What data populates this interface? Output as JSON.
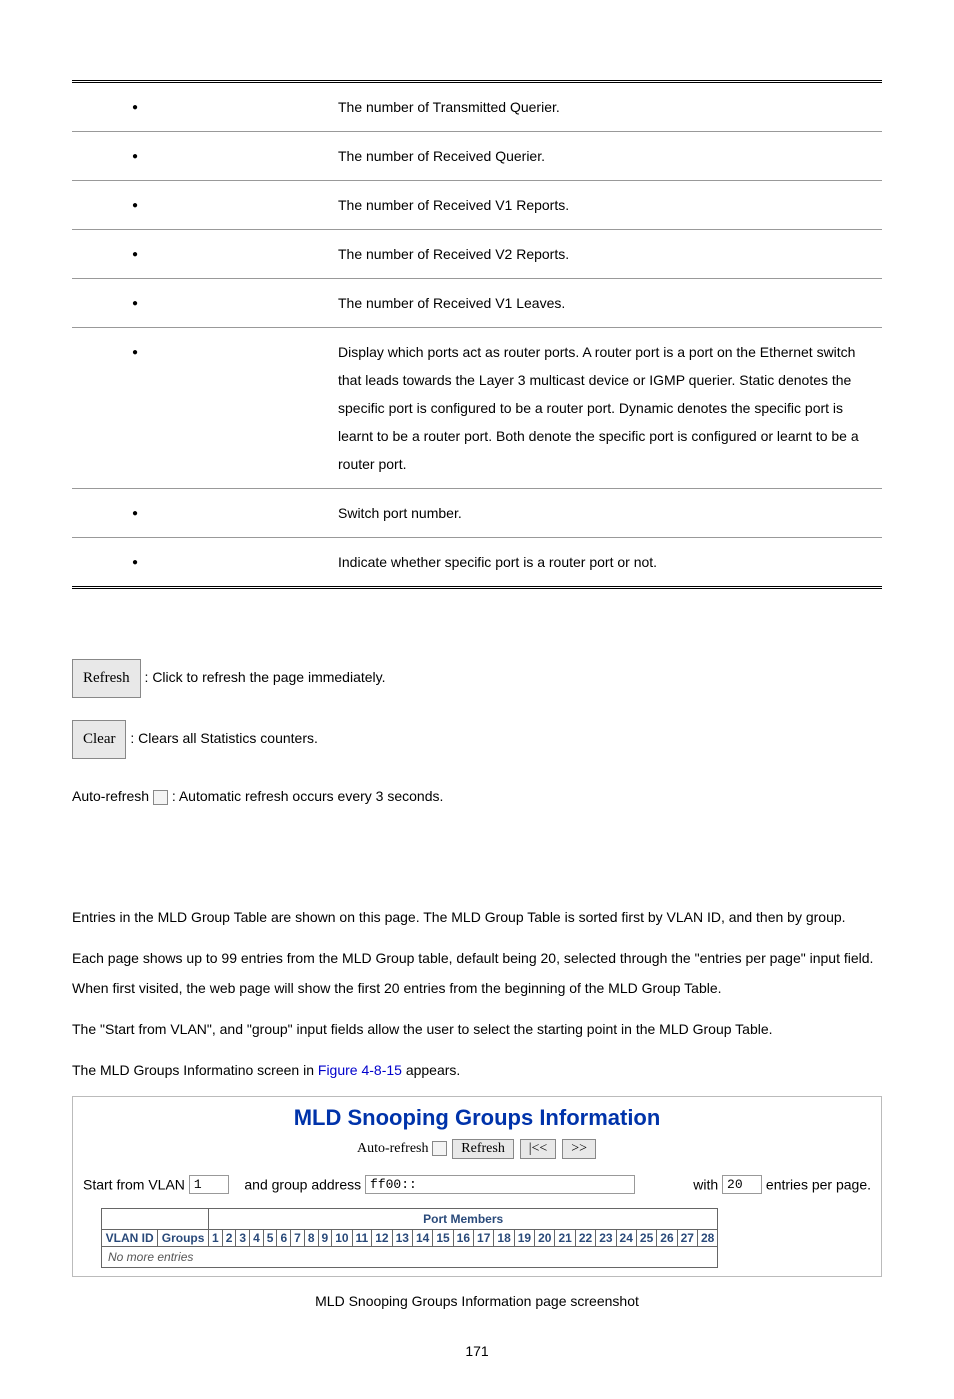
{
  "table_rows": [
    "The number of Transmitted Querier.",
    "The number of Received Querier.",
    "The number of Received V1 Reports.",
    "The number of Received V2 Reports.",
    "The number of Received V1 Leaves.",
    "Display which ports act as router ports. A router port is a port on the Ethernet switch that leads towards the Layer 3 multicast device or IGMP querier. Static denotes the specific port is configured to be a router port. Dynamic denotes the specific port is learnt to be a router port. Both denote the specific port is configured or learnt to be a router port.",
    "Switch port number.",
    "Indicate whether specific port is a router port or not."
  ],
  "buttons": {
    "refresh": "Refresh",
    "refresh_desc": ": Click to refresh the page immediately.",
    "clear": "Clear",
    "clear_desc": ": Clears all Statistics counters.",
    "autorefresh_pre": "Auto-refresh ",
    "autorefresh_desc": ": Automatic refresh occurs every 3 seconds."
  },
  "intro": {
    "p1": "Entries in the MLD Group Table are shown on this page. The MLD Group Table is sorted first by VLAN ID, and then by group.",
    "p2": "Each page shows up to 99 entries from the MLD Group table, default being 20, selected through the \"entries per page\" input field. When first visited, the web page will show the first 20 entries from the beginning of the MLD Group Table.",
    "p3": "The \"Start from VLAN\", and \"group\" input fields allow the user to select the starting point in the MLD Group Table.",
    "p4_pre": "The MLD Groups Informatino screen in ",
    "p4_link": "Figure 4-8-15",
    "p4_post": " appears."
  },
  "panel": {
    "title": "MLD Snooping Groups Information",
    "autorefresh_label": "Auto-refresh",
    "btn_refresh": "Refresh",
    "btn_first": "|<<",
    "btn_next": ">>",
    "start_from_vlan_label": "Start from VLAN",
    "start_from_vlan_value": "1",
    "and_group_addr_label": "and group address",
    "and_group_addr_value": "ff00::",
    "with_label": "with",
    "with_value": "20",
    "entries_label": "entries per page.",
    "port_members_label": "Port Members",
    "vlan_id_label": "VLAN ID",
    "groups_label": "Groups",
    "port_count": 28,
    "no_more": "No more entries"
  },
  "caption": "MLD Snooping Groups Information page screenshot",
  "page_number": "171"
}
